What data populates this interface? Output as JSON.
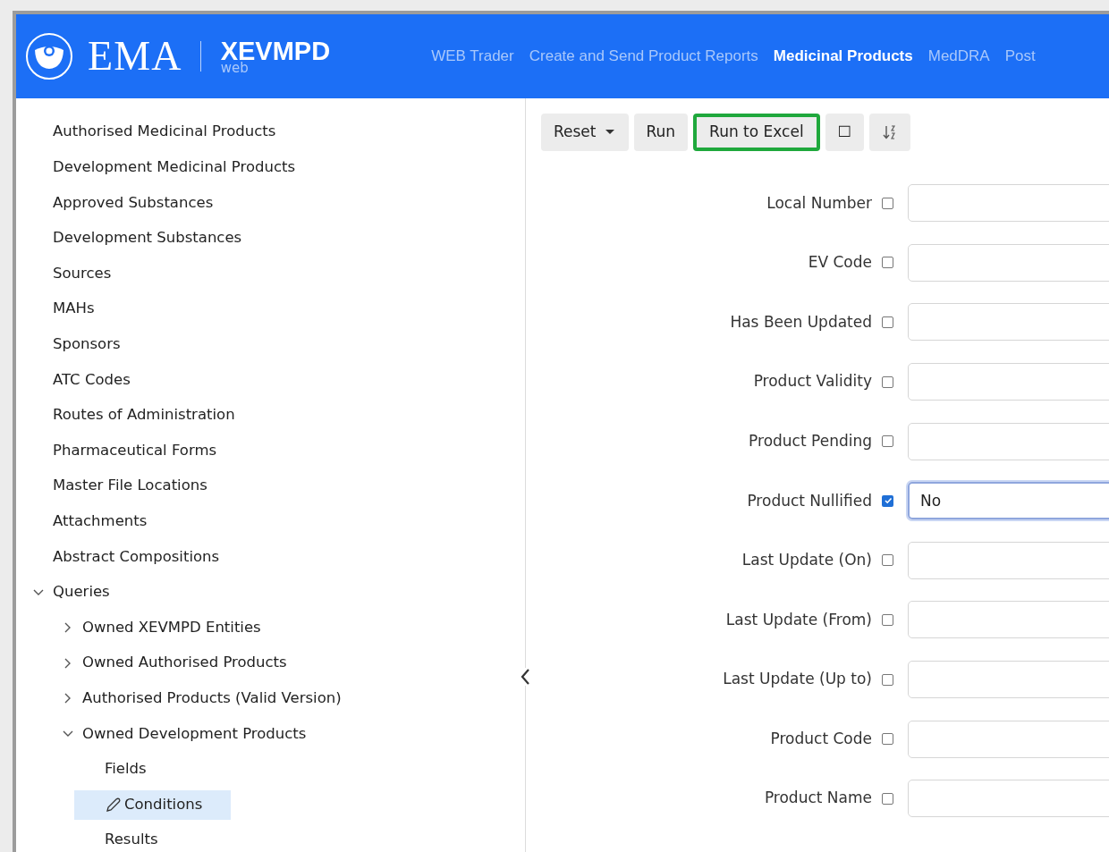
{
  "header": {
    "logo_text": "EMA",
    "app_name": "XEVMPD",
    "app_sub": "web",
    "nav": [
      {
        "label": "WEB Trader",
        "selected": false
      },
      {
        "label": "Create and Send Product Reports",
        "selected": false
      },
      {
        "label": "Medicinal Products",
        "selected": true
      },
      {
        "label": "MedDRA",
        "selected": false
      },
      {
        "label": "Post",
        "selected": false
      }
    ]
  },
  "sidebar": {
    "items": [
      {
        "label": "Authorised Medicinal Products",
        "selected": false
      },
      {
        "label": "Development Medicinal Products",
        "selected": false
      },
      {
        "label": "Approved Substances",
        "selected": false
      },
      {
        "label": "Development Substances",
        "selected": false
      },
      {
        "label": "Sources",
        "selected": false
      },
      {
        "label": "MAHs",
        "selected": false
      },
      {
        "label": "Sponsors",
        "selected": false
      },
      {
        "label": "ATC Codes",
        "selected": false
      },
      {
        "label": "Routes of Administration",
        "selected": false
      },
      {
        "label": "Pharmaceutical Forms",
        "selected": false
      },
      {
        "label": "Master File Locations",
        "selected": false
      },
      {
        "label": "Attachments",
        "selected": false
      },
      {
        "label": "Abstract Compositions",
        "selected": false
      },
      {
        "label": "Queries",
        "selected": false,
        "expanded": true,
        "children": [
          {
            "label": "Owned XEVMPD Entities",
            "selected": false,
            "expanded": false
          },
          {
            "label": "Owned Authorised Products",
            "selected": false,
            "expanded": false
          },
          {
            "label": "Authorised Products (Valid Version)",
            "selected": false,
            "expanded": false
          },
          {
            "label": "Owned Development Products",
            "selected": false,
            "expanded": true,
            "children": [
              {
                "label": "Fields",
                "selected": false
              },
              {
                "label": "Conditions",
                "selected": true
              },
              {
                "label": "Results",
                "selected": false
              }
            ]
          }
        ]
      }
    ]
  },
  "toolbar": [
    {
      "kind": "dropdown",
      "label": "Reset",
      "highlighted": false
    },
    {
      "kind": "text",
      "label": "Run",
      "highlighted": false
    },
    {
      "kind": "text",
      "label": "Run to Excel",
      "highlighted": true
    },
    {
      "kind": "text",
      "label": "☐",
      "highlighted": false
    },
    {
      "kind": "sort",
      "highlighted": false
    }
  ],
  "conditions": [
    {
      "label": "Local Number",
      "checked": false
    },
    {
      "label": "EV Code",
      "checked": false
    },
    {
      "label": "Has Been Updated",
      "checked": false
    },
    {
      "label": "Product Validity",
      "checked": false
    },
    {
      "label": "Product Pending",
      "checked": false
    },
    {
      "label": "Product Nullified",
      "checked": true,
      "value": "No"
    },
    {
      "label": "Last Update (On)",
      "checked": false
    },
    {
      "label": "Last Update (From)",
      "checked": false
    },
    {
      "label": "Last Update (Up to)",
      "checked": false
    },
    {
      "label": "Product Code",
      "checked": false
    },
    {
      "label": "Product Name",
      "checked": false
    }
  ]
}
